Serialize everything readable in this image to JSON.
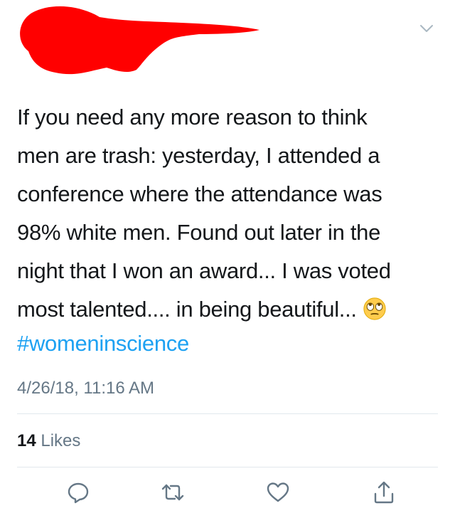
{
  "tweet": {
    "text_lines": [
      "If you need any more reason to think",
      "men are trash: yesterday, I attended a",
      "conference where the attendance was",
      "98% white men. Found out later in the",
      "night that I won an award... I was voted",
      "most talented.... in being beautiful..."
    ],
    "emoji": "face-with-rolling-eyes",
    "hashtag": "#womeninscience",
    "timestamp": "4/26/18, 11:16 AM",
    "likes_count": "14",
    "likes_label": " Likes"
  },
  "header": {
    "menu_icon": "chevron-down-icon",
    "redaction_color": "#ff0000"
  },
  "actions": {
    "reply_icon": "reply-icon",
    "retweet_icon": "retweet-icon",
    "like_icon": "heart-icon",
    "share_icon": "share-icon"
  },
  "colors": {
    "text": "#14171a",
    "secondary": "#657786",
    "link": "#1da1f2",
    "divider": "#e1e8ed"
  }
}
